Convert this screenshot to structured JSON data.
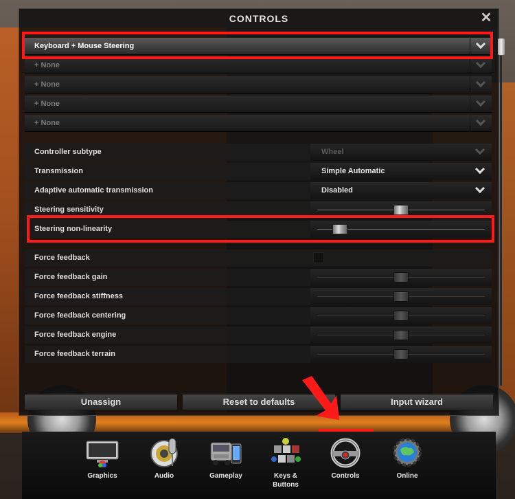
{
  "window": {
    "title": "CONTROLS",
    "close_symbol": "✕"
  },
  "profiles": {
    "selected": "Keyboard + Mouse Steering",
    "slots": [
      "+ None",
      "+ None",
      "+ None",
      "+ None"
    ]
  },
  "settings": [
    {
      "label": "Controller subtype",
      "type": "dropdown",
      "value": "Wheel",
      "enabled": false
    },
    {
      "label": "Transmission",
      "type": "dropdown",
      "value": "Simple Automatic",
      "enabled": true
    },
    {
      "label": "Adaptive automatic transmission",
      "type": "dropdown",
      "value": "Disabled",
      "enabled": true
    },
    {
      "label": "Steering sensitivity",
      "type": "slider",
      "level": 0.5,
      "enabled": true
    },
    {
      "label": "Steering non-linearity",
      "type": "slider",
      "level": 0.1,
      "enabled": true
    },
    {
      "label": "Force feedback",
      "type": "checkbox",
      "enabled": false
    },
    {
      "label": "Force feedback gain",
      "type": "slider",
      "level": 0.5,
      "enabled": false
    },
    {
      "label": "Force feedback stiffness",
      "type": "slider",
      "level": 0.5,
      "enabled": false
    },
    {
      "label": "Force feedback centering",
      "type": "slider",
      "level": 0.5,
      "enabled": false
    },
    {
      "label": "Force feedback engine",
      "type": "slider",
      "level": 0.5,
      "enabled": false
    },
    {
      "label": "Force feedback terrain",
      "type": "slider",
      "level": 0.5,
      "enabled": false
    }
  ],
  "buttons": {
    "unassign": "Unassign",
    "reset": "Reset to defaults",
    "wizard": "Input wizard"
  },
  "nav": [
    {
      "label": "Graphics",
      "icon": "monitor-icon"
    },
    {
      "label": "Audio",
      "icon": "microphone-icon"
    },
    {
      "label": "Gameplay",
      "icon": "truck-phone-icon"
    },
    {
      "label": "Keys &\nButtons",
      "icon": "keys-buttons-icon"
    },
    {
      "label": "Controls",
      "icon": "steering-wheel-icon",
      "active": true
    },
    {
      "label": "Online",
      "icon": "globe-gear-icon"
    }
  ],
  "colors": {
    "highlight": "#ff1a1a",
    "accent_orange": "#c8601e"
  }
}
